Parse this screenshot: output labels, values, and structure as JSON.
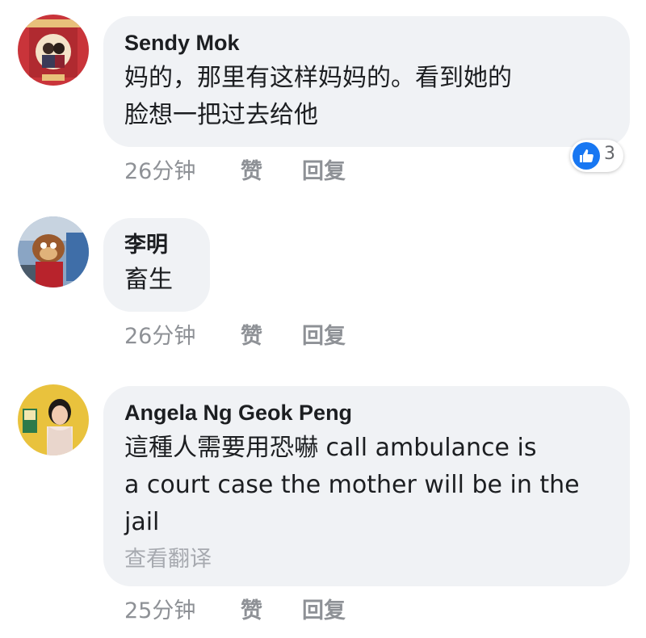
{
  "comments": [
    {
      "author": "Sendy Mok",
      "lines": [
        "妈的，那里有这样妈妈的。看到她的",
        "脸想一把过去给他"
      ],
      "time": "26分钟",
      "like_label": "赞",
      "reply_label": "回复",
      "reaction": {
        "icon": "thumbs-up-icon",
        "color": "#1877f2",
        "count": "3"
      }
    },
    {
      "author": "李明",
      "lines": [
        "畜生"
      ],
      "time": "26分钟",
      "like_label": "赞",
      "reply_label": "回复"
    },
    {
      "author": "Angela Ng Geok Peng",
      "lines": [
        "這種人需要用恐嚇 call ambulance is",
        "a court case the mother will be in the",
        "jail"
      ],
      "translate_label": "查看翻译",
      "time": "25分钟",
      "like_label": "赞",
      "reply_label": "回复"
    }
  ]
}
